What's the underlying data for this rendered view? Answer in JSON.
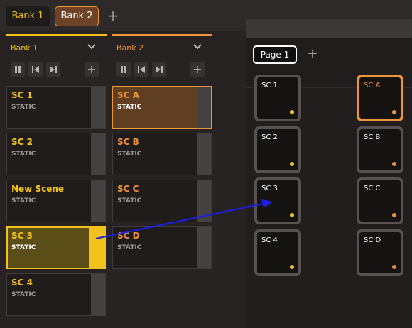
{
  "tabs": [
    {
      "label": "Bank 1"
    },
    {
      "label": "Bank 2"
    }
  ],
  "add_tab_label": "+",
  "banks": [
    {
      "name": "Bank 1",
      "color": "#f2c21b",
      "scenes": [
        {
          "name": "SC 1",
          "type": "STATIC"
        },
        {
          "name": "SC 2",
          "type": "STATIC"
        },
        {
          "name": "New Scene",
          "type": "STATIC"
        },
        {
          "name": "SC 3",
          "type": "STATIC"
        },
        {
          "name": "SC 4",
          "type": "STATIC"
        }
      ]
    },
    {
      "name": "Bank 2",
      "color": "#f0943a",
      "scenes": [
        {
          "name": "SC A",
          "type": "STATIC"
        },
        {
          "name": "SC B",
          "type": "STATIC"
        },
        {
          "name": "SC C",
          "type": "STATIC"
        },
        {
          "name": "SC D",
          "type": "STATIC"
        }
      ]
    }
  ],
  "controls": {
    "pause_icon": "pause-icon",
    "prev_icon": "skip-back-icon",
    "next_icon": "skip-forward-icon",
    "add_label": "+"
  },
  "page": {
    "tab_label": "Page 1",
    "add_label": "+",
    "pads_left": [
      {
        "name": "SC 1"
      },
      {
        "name": "SC 2"
      },
      {
        "name": "SC 3"
      },
      {
        "name": "SC 4"
      }
    ],
    "pads_right": [
      {
        "name": "SC A"
      },
      {
        "name": "SC B"
      },
      {
        "name": "SC C"
      },
      {
        "name": "SC D"
      }
    ]
  },
  "colors": {
    "bank1": "#f2c21b",
    "bank2": "#f0943a",
    "arrow": "#1a1ff0"
  }
}
